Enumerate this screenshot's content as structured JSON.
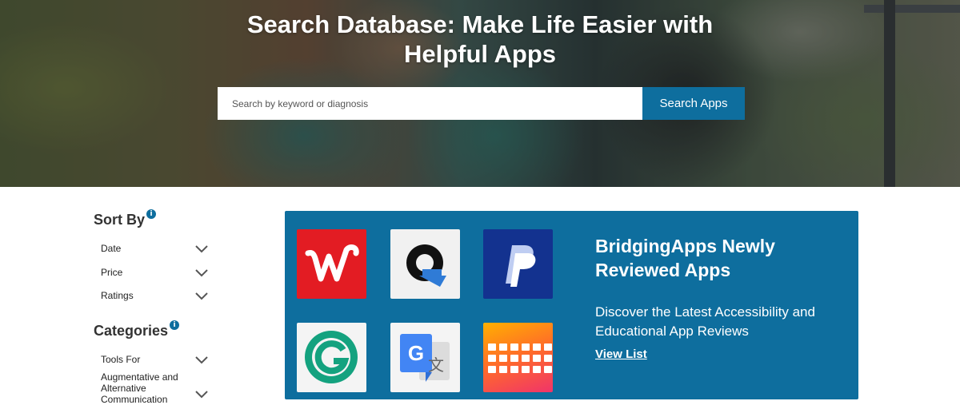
{
  "hero": {
    "title_line1": "Search Database: Make Life Easier with",
    "title_line2": "Helpful Apps",
    "search_placeholder": "Search by keyword or diagnosis",
    "search_button": "Search Apps"
  },
  "sidebar": {
    "sort_title": "Sort By",
    "sort_items": [
      {
        "label": "Date"
      },
      {
        "label": "Price"
      },
      {
        "label": "Ratings"
      }
    ],
    "categories_title": "Categories",
    "category_items": [
      {
        "label": "Tools For"
      },
      {
        "label": "Augmentative and Alternative Communication"
      }
    ]
  },
  "feature": {
    "title": "BridgingApps Newly Reviewed Apps",
    "description": "Discover the Latest Accessibility and Educational App Reviews",
    "link": "View List",
    "apps": [
      {
        "icon": "walgreens-icon"
      },
      {
        "icon": "speech-bubble-app-icon"
      },
      {
        "icon": "paypal-icon"
      },
      {
        "icon": "grammarly-icon"
      },
      {
        "icon": "google-translate-icon"
      },
      {
        "icon": "keyboard-app-icon"
      }
    ]
  },
  "colors": {
    "accent": "#0e6e9e",
    "text_dark": "#333333"
  }
}
